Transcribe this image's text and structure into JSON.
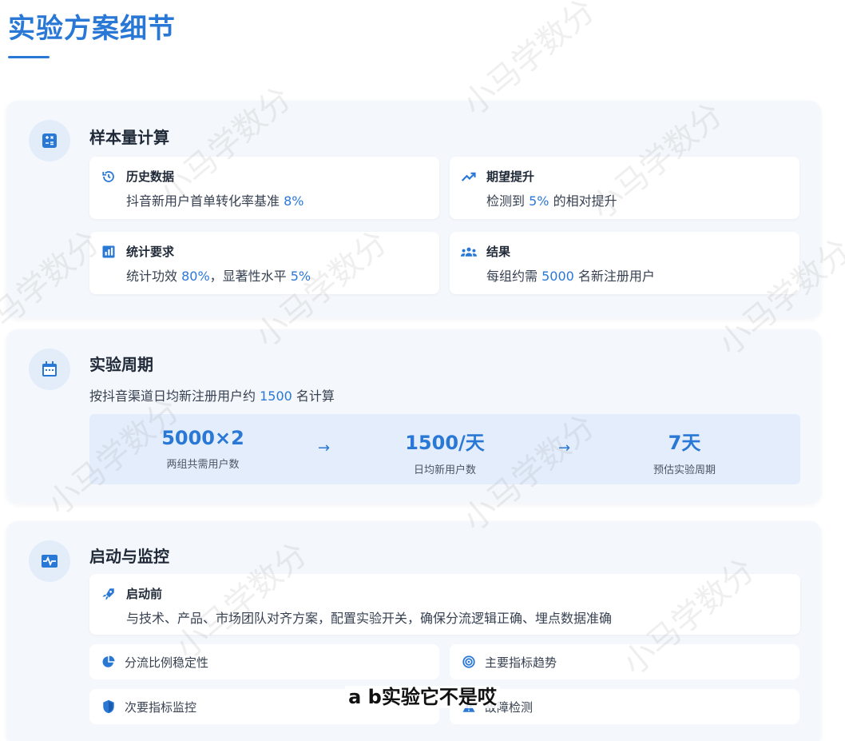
{
  "page_title": "实验方案细节",
  "colors": {
    "accent": "#2a78d6",
    "section_bg": "#f4f7fb",
    "flow_bg": "#e3edfb"
  },
  "sample": {
    "title": "样本量计算",
    "icon": "calculator-icon",
    "history": {
      "title": "历史数据",
      "icon": "history-icon",
      "text": "抖音新用户首单转化率基准 ",
      "value": "8%"
    },
    "expected": {
      "title": "期望提升",
      "icon": "trend-up-icon",
      "text_pre": "检测到 ",
      "value": "5%",
      "text_post": " 的相对提升"
    },
    "stats": {
      "title": "统计要求",
      "icon": "bar-chart-icon",
      "text_pre": "统计功效 ",
      "value1": "80%",
      "text_mid": "，显著性水平 ",
      "value2": "5%"
    },
    "result": {
      "title": "结果",
      "icon": "users-icon",
      "text_pre": "每组约需 ",
      "value": "5000",
      "text_post": " 名新注册用户"
    }
  },
  "period": {
    "title": "实验周期",
    "icon": "calendar-icon",
    "desc_pre": "按抖音渠道日均新注册用户约 ",
    "desc_value": "1500",
    "desc_post": " 名计算",
    "flow": [
      {
        "value": "5000×2",
        "label": "两组共需用户数"
      },
      {
        "value": "1500/天",
        "label": "日均新用户数"
      },
      {
        "value": "7天",
        "label": "预估实验周期"
      }
    ],
    "arrow": "→"
  },
  "launch": {
    "title": "启动与监控",
    "icon": "pulse-icon",
    "pre": {
      "title": "启动前",
      "icon": "rocket-icon",
      "text": "与技术、产品、市场团队对齐方案，配置实验开关，确保分流逻辑正确、埋点数据准确"
    },
    "items": [
      {
        "label": "分流比例稳定性",
        "icon": "pie-chart-icon"
      },
      {
        "label": "主要指标趋势",
        "icon": "target-icon"
      },
      {
        "label": "次要指标监控",
        "icon": "shield-icon"
      },
      {
        "label": "故障检测",
        "icon": "alert-icon"
      }
    ]
  },
  "caption": "a b实验它不是哎",
  "watermark": "小马学数分"
}
